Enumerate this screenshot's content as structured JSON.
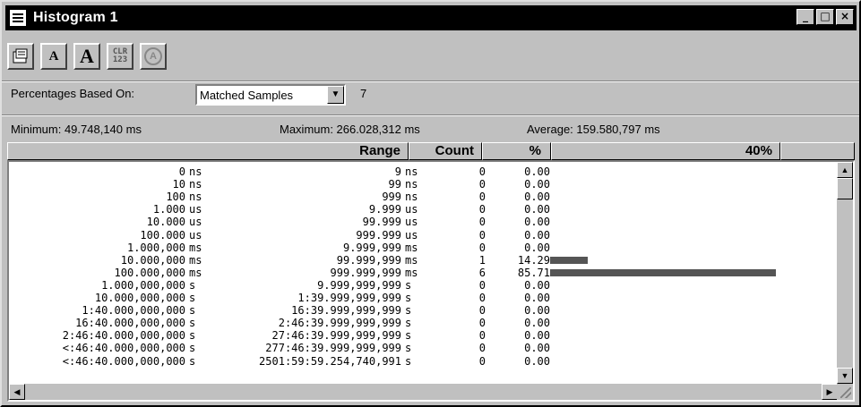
{
  "window": {
    "title": "Histogram 1",
    "controls": {
      "minimize": "_",
      "maximize": "□",
      "close": "×"
    }
  },
  "toolbar": {
    "buttons": [
      {
        "name": "properties-icon"
      },
      {
        "name": "font-smaller-button",
        "label": "A"
      },
      {
        "name": "font-larger-button",
        "label": "A"
      },
      {
        "name": "clear-button",
        "label_top": "CLR",
        "label_bottom": "123"
      },
      {
        "name": "auto-button",
        "label": "A"
      }
    ]
  },
  "percentages": {
    "label": "Percentages Based On:",
    "selected": "Matched Samples",
    "count": "7"
  },
  "stats": {
    "minimum": "Minimum: 49.748,140 ms",
    "maximum": "Maximum: 266.028,312 ms",
    "average": "Average: 159.580,797 ms"
  },
  "headers": {
    "range": "Range",
    "count": "Count",
    "percent": "%",
    "bar_scale": "40%"
  },
  "rows": [
    {
      "from": "0",
      "from_unit": "ns",
      "to": "9",
      "to_unit": "ns",
      "count": "0",
      "pct": "0.00",
      "frac": 0
    },
    {
      "from": "10",
      "from_unit": "ns",
      "to": "99",
      "to_unit": "ns",
      "count": "0",
      "pct": "0.00",
      "frac": 0
    },
    {
      "from": "100",
      "from_unit": "ns",
      "to": "999",
      "to_unit": "ns",
      "count": "0",
      "pct": "0.00",
      "frac": 0
    },
    {
      "from": "1.000",
      "from_unit": "us",
      "to": "9.999",
      "to_unit": "us",
      "count": "0",
      "pct": "0.00",
      "frac": 0
    },
    {
      "from": "10.000",
      "from_unit": "us",
      "to": "99.999",
      "to_unit": "us",
      "count": "0",
      "pct": "0.00",
      "frac": 0
    },
    {
      "from": "100.000",
      "from_unit": "us",
      "to": "999.999",
      "to_unit": "us",
      "count": "0",
      "pct": "0.00",
      "frac": 0
    },
    {
      "from": "1.000,000",
      "from_unit": "ms",
      "to": "9.999,999",
      "to_unit": "ms",
      "count": "0",
      "pct": "0.00",
      "frac": 0
    },
    {
      "from": "10.000,000",
      "from_unit": "ms",
      "to": "99.999,999",
      "to_unit": "ms",
      "count": "1",
      "pct": "14.29",
      "frac": 0.1429
    },
    {
      "from": "100.000,000",
      "from_unit": "ms",
      "to": "999.999,999",
      "to_unit": "ms",
      "count": "6",
      "pct": "85.71",
      "frac": 0.8571
    },
    {
      "from": "1.000,000,000",
      "from_unit": "s",
      "to": "9.999,999,999",
      "to_unit": "s",
      "count": "0",
      "pct": "0.00",
      "frac": 0
    },
    {
      "from": "10.000,000,000",
      "from_unit": "s",
      "to": "1:39.999,999,999",
      "to_unit": "s",
      "count": "0",
      "pct": "0.00",
      "frac": 0
    },
    {
      "from": "1:40.000,000,000",
      "from_unit": "s",
      "to": "16:39.999,999,999",
      "to_unit": "s",
      "count": "0",
      "pct": "0.00",
      "frac": 0
    },
    {
      "from": "16:40.000,000,000",
      "from_unit": "s",
      "to": "2:46:39.999,999,999",
      "to_unit": "s",
      "count": "0",
      "pct": "0.00",
      "frac": 0
    },
    {
      "from": "2:46:40.000,000,000",
      "from_unit": "s",
      "to": "27:46:39.999,999,999",
      "to_unit": "s",
      "count": "0",
      "pct": "0.00",
      "frac": 0
    },
    {
      "from": "<:46:40.000,000,000",
      "from_unit": "s",
      "to": "277:46:39.999,999,999",
      "to_unit": "s",
      "count": "0",
      "pct": "0.00",
      "frac": 0
    },
    {
      "from": "<:46:40.000,000,000",
      "from_unit": "s",
      "to": "2501:59:59.254,740,991",
      "to_unit": "s",
      "count": "0",
      "pct": "0.00",
      "frac": 0
    }
  ],
  "scrollbar": {
    "up": "▲",
    "down": "▼",
    "left": "◀",
    "right": "▶"
  }
}
